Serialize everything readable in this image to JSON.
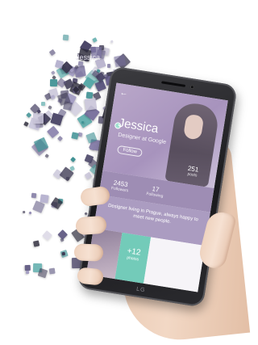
{
  "profile": {
    "name": "Jessica",
    "job": "Designer at Google",
    "follow_label": "Follow",
    "stats": [
      {
        "value": "251",
        "label": "posts"
      },
      {
        "value": "2453",
        "label": "Followers"
      },
      {
        "value": "17",
        "label": "Following"
      }
    ],
    "bio": "Designer living in Prague, always happy to meet new people.",
    "more_photos": {
      "count": "+12",
      "label": "photos"
    }
  },
  "phone": {
    "brand": "LG"
  },
  "particles_text": [
    "Jessica",
    "happ"
  ],
  "colors": {
    "accent_purple": "#a793bd",
    "accent_teal": "#73cbb9",
    "particle_dark": "#2a2838"
  }
}
